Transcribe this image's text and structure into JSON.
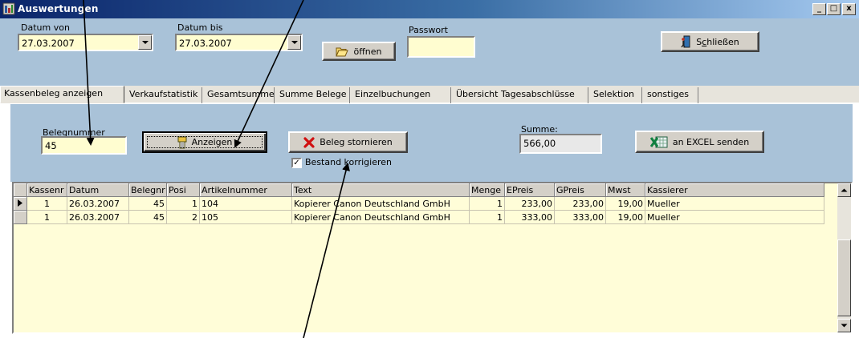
{
  "window": {
    "title": "Auswertungen",
    "controls": {
      "minimize": "_",
      "maximize": "□",
      "close": "x"
    }
  },
  "top_panel": {
    "datum_von_label": "Datum von",
    "datum_von_value": "27.03.2007",
    "datum_bis_label": "Datum bis",
    "datum_bis_value": "27.03.2007",
    "oeffnen_label": "öffnen",
    "passwort_label": "Passwort",
    "passwort_value": "",
    "schliessen_label": "Schließen"
  },
  "tabs": [
    {
      "label": "Kassenbeleg anzeigen",
      "active": true
    },
    {
      "label": "Verkaufstatistik"
    },
    {
      "label": "Gesamtsumme"
    },
    {
      "label": "Summe Belege"
    },
    {
      "label": "Einzelbuchungen"
    },
    {
      "label": "Übersicht Tagesabschlüsse"
    },
    {
      "label": "Selektion"
    },
    {
      "label": "sonstiges"
    }
  ],
  "tab_panel": {
    "belegnummer_label": "Belegnummer",
    "belegnummer_value": "45",
    "anzeigen_label": "Anzeigen",
    "beleg_stornieren_label": "Beleg stornieren",
    "bestand_korrigieren_label": "Bestand korrigieren",
    "bestand_korrigieren_checked": true,
    "summe_label": "Summe:",
    "summe_value": "566,00",
    "excel_label": "an EXCEL senden"
  },
  "grid": {
    "columns": [
      "Kassenr",
      "Datum",
      "Belegnr",
      "Posi",
      "Artikelnummer",
      "Text",
      "Menge",
      "EPreis",
      "GPreis",
      "Mwst",
      "Kassierer"
    ],
    "rows": [
      [
        "1",
        "26.03.2007",
        "45",
        "1",
        "104",
        "Kopierer Canon Deutschland GmbH",
        "1",
        "233,00",
        "233,00",
        "19,00",
        "Mueller"
      ],
      [
        "1",
        "26.03.2007",
        "45",
        "2",
        "105",
        "Kopierer Canon Deutschland GmbH",
        "1",
        "333,00",
        "333,00",
        "19,00",
        "Mueller"
      ]
    ]
  },
  "colors": {
    "panel": "#a9c2d8",
    "field": "#fffdd0",
    "titlebar": "#0a246a"
  }
}
